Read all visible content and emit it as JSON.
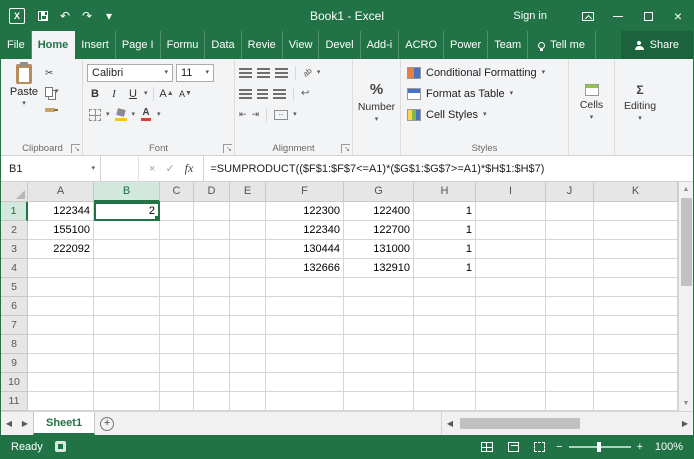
{
  "app": {
    "title": "Book1 - Excel",
    "sign_in": "Sign in"
  },
  "icons": {
    "dropdown": "▾",
    "undo": "↶",
    "redo": "↷",
    "cut": "✂",
    "close": "×",
    "cancel": "×",
    "check": "✓",
    "dialog_launcher": "↘",
    "nav_left": "◀",
    "nav_right": "▶",
    "scroll_up": "▲",
    "scroll_down": "▼",
    "add_sheet": "+",
    "zoom_out": "−",
    "zoom_in": "+",
    "sigma": "Σ",
    "wrap": "↩",
    "orientation": "ab",
    "indent_left": "⇤",
    "indent_right": "⇥",
    "merge_arrows": "↔"
  },
  "tabs": {
    "items": [
      {
        "label": "File",
        "active": false
      },
      {
        "label": "Home",
        "active": true
      },
      {
        "label": "Insert",
        "active": false
      },
      {
        "label": "Page I",
        "active": false
      },
      {
        "label": "Formu",
        "active": false
      },
      {
        "label": "Data",
        "active": false
      },
      {
        "label": "Revie",
        "active": false
      },
      {
        "label": "View",
        "active": false
      },
      {
        "label": "Devel",
        "active": false
      },
      {
        "label": "Add-i",
        "active": false
      },
      {
        "label": "ACRO",
        "active": false
      },
      {
        "label": "Power",
        "active": false
      },
      {
        "label": "Team",
        "active": false
      }
    ],
    "tell_me": "Tell me",
    "share": "Share"
  },
  "ribbon": {
    "clipboard": {
      "group_label": "Clipboard",
      "paste_label": "Paste"
    },
    "font": {
      "group_label": "Font",
      "font_name": "Calibri",
      "font_size": "11",
      "bold": "B",
      "italic": "I",
      "underline": "U",
      "grow": "A",
      "shrink": "A",
      "color_letter": "A"
    },
    "alignment": {
      "group_label": "Alignment"
    },
    "number": {
      "percent": "%",
      "label": "Number"
    },
    "styles": {
      "group_label": "Styles",
      "items": [
        {
          "label": "Conditional Formatting"
        },
        {
          "label": "Format as Table"
        },
        {
          "label": "Cell Styles"
        }
      ]
    },
    "cells": {
      "label": "Cells"
    },
    "editing": {
      "label": "Editing"
    }
  },
  "formula_bar": {
    "name_box": "B1",
    "fx_label": "fx",
    "formula": "=SUMPRODUCT(($F$1:$F$7<=A1)*($G$1:$G$7>=A1)*$H$1:$H$7)"
  },
  "grid": {
    "columns": [
      "A",
      "B",
      "C",
      "D",
      "E",
      "F",
      "G",
      "H",
      "I",
      "J",
      "K"
    ],
    "visible_rows": 11,
    "selected_column": "B",
    "selected_row": 1,
    "active_cell": {
      "col": "B",
      "row": 1
    },
    "cells": [
      {
        "row": 1,
        "col": "A",
        "value": "122344"
      },
      {
        "row": 1,
        "col": "B",
        "value": "2"
      },
      {
        "row": 1,
        "col": "F",
        "value": "122300"
      },
      {
        "row": 1,
        "col": "G",
        "value": "122400"
      },
      {
        "row": 1,
        "col": "H",
        "value": "1"
      },
      {
        "row": 2,
        "col": "A",
        "value": "155100"
      },
      {
        "row": 2,
        "col": "F",
        "value": "122340"
      },
      {
        "row": 2,
        "col": "G",
        "value": "122700"
      },
      {
        "row": 2,
        "col": "H",
        "value": "1"
      },
      {
        "row": 3,
        "col": "A",
        "value": "222092"
      },
      {
        "row": 3,
        "col": "F",
        "value": "130444"
      },
      {
        "row": 3,
        "col": "G",
        "value": "131000"
      },
      {
        "row": 3,
        "col": "H",
        "value": "1"
      },
      {
        "row": 4,
        "col": "F",
        "value": "132666"
      },
      {
        "row": 4,
        "col": "G",
        "value": "132910"
      },
      {
        "row": 4,
        "col": "H",
        "value": "1"
      }
    ]
  },
  "sheet_bar": {
    "active_tab": "Sheet1"
  },
  "status_bar": {
    "mode": "Ready",
    "zoom_level": "100%"
  },
  "colors": {
    "accent_green": "#217346",
    "selected_header_bg": "#d3e8dc",
    "grid_line": "#d6d6d6"
  }
}
